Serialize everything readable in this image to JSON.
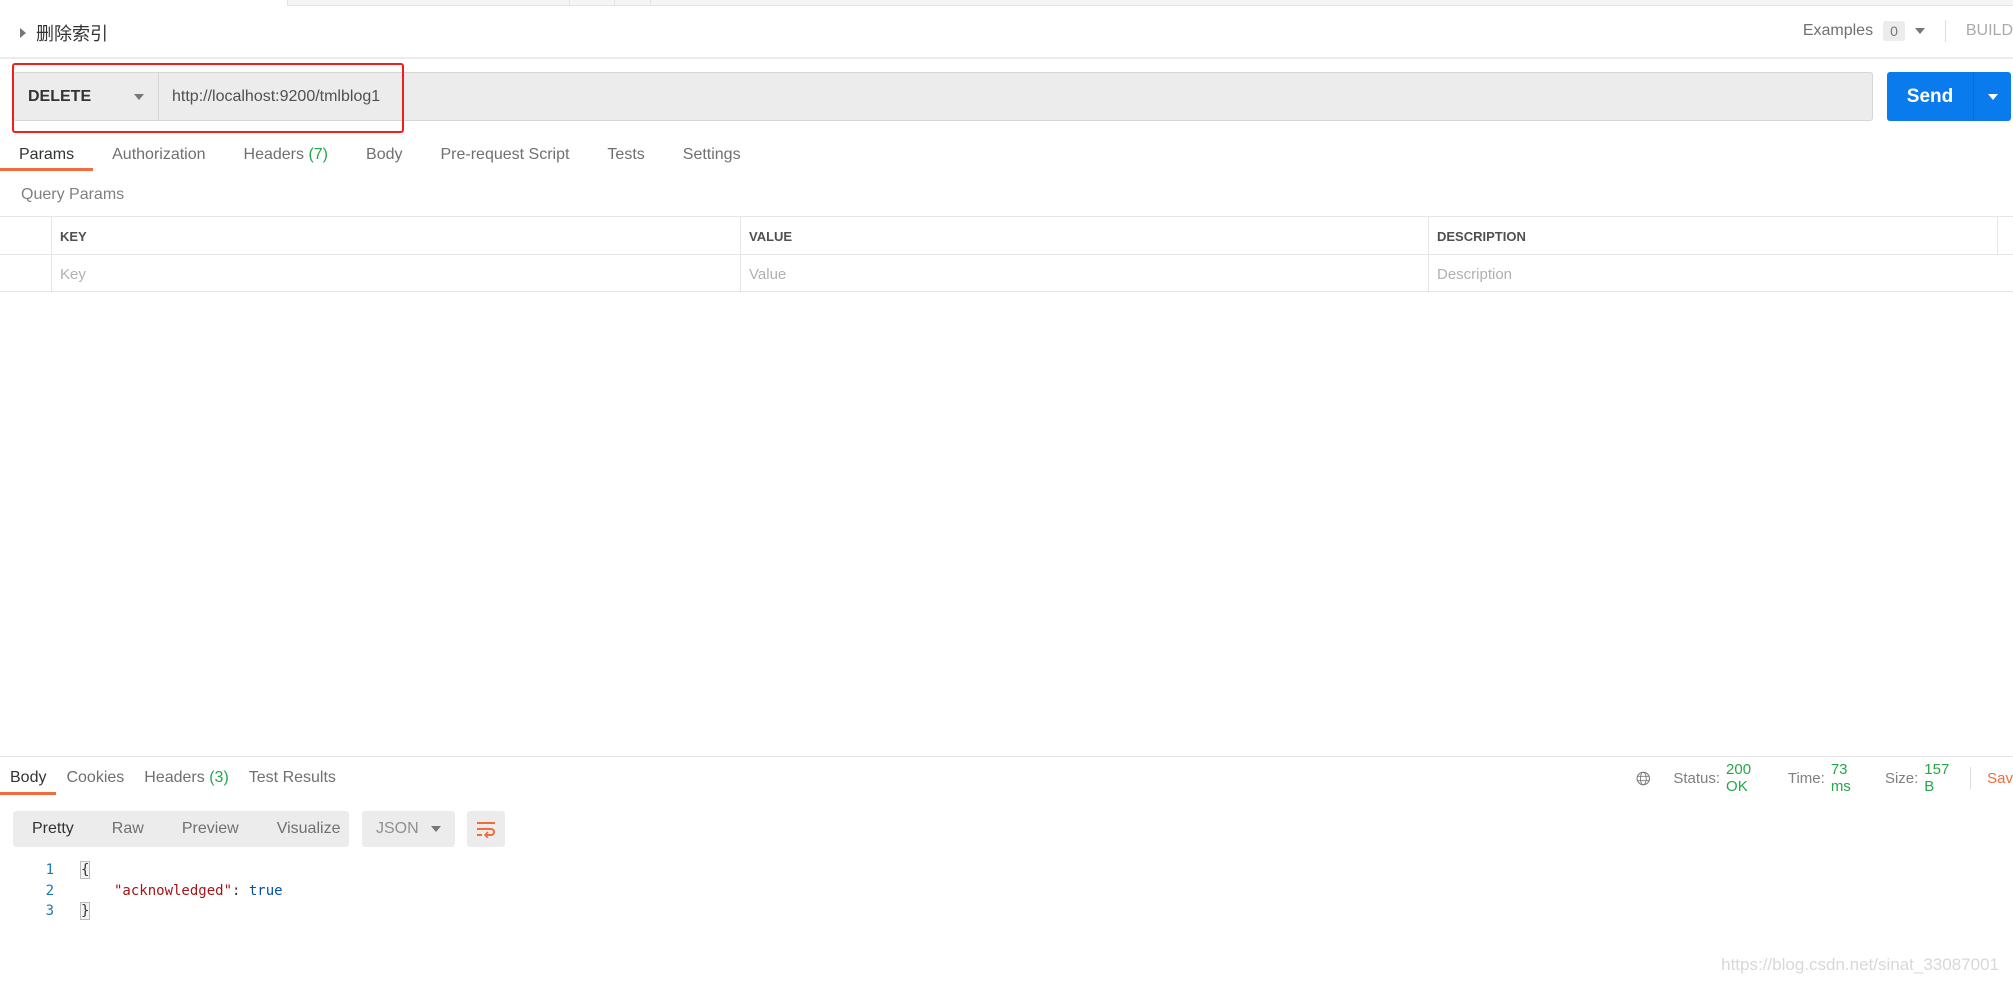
{
  "request": {
    "title": "删除索引",
    "examples_label": "Examples",
    "examples_count": "0",
    "build_label": "BUILD",
    "method": "DELETE",
    "url": "http://localhost:9200/tmlblog1",
    "send_label": "Send",
    "highlight_color": "#f21d1d"
  },
  "request_tabs": [
    {
      "label": "Params",
      "active": true
    },
    {
      "label": "Authorization"
    },
    {
      "label": "Headers",
      "count": "(7)"
    },
    {
      "label": "Body"
    },
    {
      "label": "Pre-request Script"
    },
    {
      "label": "Tests"
    },
    {
      "label": "Settings"
    }
  ],
  "query_params": {
    "title": "Query Params",
    "columns": [
      "KEY",
      "VALUE",
      "DESCRIPTION"
    ],
    "placeholders": [
      "Key",
      "Value",
      "Description"
    ]
  },
  "response": {
    "tabs": [
      {
        "label": "Body",
        "active": true
      },
      {
        "label": "Cookies"
      },
      {
        "label": "Headers",
        "count": "(3)"
      },
      {
        "label": "Test Results"
      }
    ],
    "status_label": "Status:",
    "status_value": "200 OK",
    "time_label": "Time:",
    "time_value": "73 ms",
    "size_label": "Size:",
    "size_value": "157 B",
    "save_label": "Sav",
    "formats": [
      "Pretty",
      "Raw",
      "Preview",
      "Visualize"
    ],
    "language": "JSON",
    "code": {
      "lines": [
        "1",
        "2",
        "3"
      ],
      "open": "{",
      "key": "\"acknowledged\"",
      "colon": ": ",
      "value": "true",
      "close": "}"
    }
  },
  "watermark": "https://blog.csdn.net/sinat_33087001",
  "colors": {
    "accent": "#f26b3a",
    "send": "#097bed",
    "success": "#26a649"
  }
}
